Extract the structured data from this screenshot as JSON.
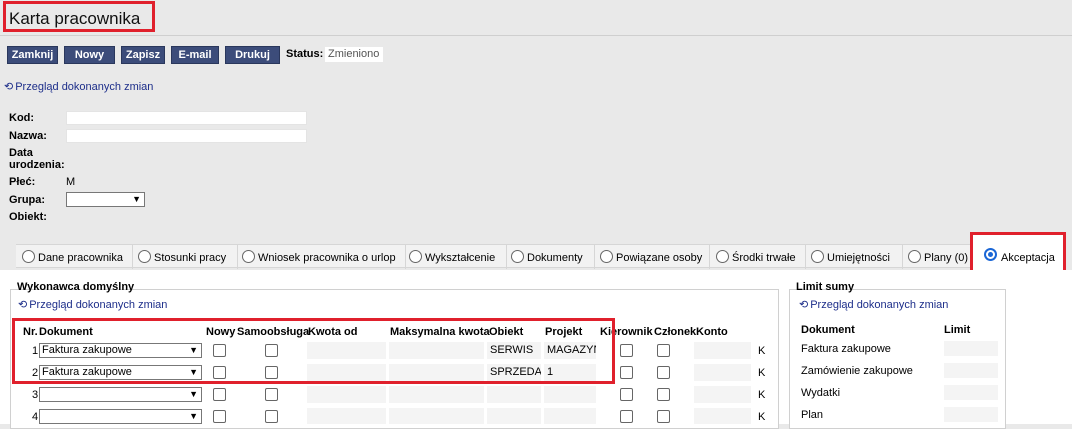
{
  "title": "Karta pracownika",
  "toolbar": {
    "close": "Zamknij",
    "new": "Nowy",
    "save": "Zapisz",
    "email": "E-mail",
    "print": "Drukuj",
    "status_label": "Status:",
    "status_value": "Zmieniono"
  },
  "history_link": "Przegląd dokonanych zmian",
  "history_icon": "history-icon",
  "form": {
    "kod_label": "Kod:",
    "kod_value": "",
    "nazwa_label": "Nazwa:",
    "nazwa_value": "",
    "data_label_1": "Data",
    "data_label_2": "urodzenia:",
    "plec_label": "Płeć:",
    "plec_value": "M",
    "grupa_label": "Grupa:",
    "grupa_value": "",
    "obiekt_label": "Obiekt:"
  },
  "tabs": [
    {
      "label": "Dane pracownika",
      "selected": false
    },
    {
      "label": "Stosunki pracy",
      "selected": false
    },
    {
      "label": "Wniosek pracownika o urlop",
      "selected": false
    },
    {
      "label": "Wykształcenie",
      "selected": false
    },
    {
      "label": "Dokumenty",
      "selected": false
    },
    {
      "label": "Powiązane osoby",
      "selected": false
    },
    {
      "label": "Środki trwałe",
      "selected": false
    },
    {
      "label": "Umiejętności",
      "selected": false
    },
    {
      "label": "Plany (0)",
      "selected": false
    },
    {
      "label": "Akceptacja",
      "selected": true
    }
  ],
  "performer": {
    "title": "Wykonawca domyślny",
    "history_link": "Przegląd dokonanych zmian",
    "headers": {
      "nr": "Nr.",
      "document": "Dokument",
      "new": "Nowy",
      "self_service": "Samoobsługa",
      "amount_from": "Kwota od",
      "max_amount": "Maksymalna kwota",
      "object": "Obiekt",
      "project": "Projekt",
      "manager": "Kierownik",
      "member": "Członek",
      "account": "Konto"
    },
    "rows": [
      {
        "nr": "1",
        "document": "Faktura zakupowe",
        "object": "SERWIS",
        "project": "MAGAZYN",
        "account_btn": "K"
      },
      {
        "nr": "2",
        "document": "Faktura zakupowe",
        "object": "SPRZEDA",
        "project": "1",
        "account_btn": "K"
      },
      {
        "nr": "3",
        "document": "",
        "object": "",
        "project": "",
        "account_btn": "K"
      },
      {
        "nr": "4",
        "document": "",
        "object": "",
        "project": "",
        "account_btn": "K"
      }
    ]
  },
  "limit": {
    "title": "Limit sumy",
    "history_link": "Przegląd dokonanych zmian",
    "headers": {
      "document": "Dokument",
      "limit": "Limit"
    },
    "rows": [
      {
        "document": "Faktura zakupowe",
        "limit": ""
      },
      {
        "document": "Zamówienie zakupowe",
        "limit": ""
      },
      {
        "document": "Wydatki",
        "limit": ""
      },
      {
        "document": "Plan",
        "limit": ""
      }
    ]
  }
}
